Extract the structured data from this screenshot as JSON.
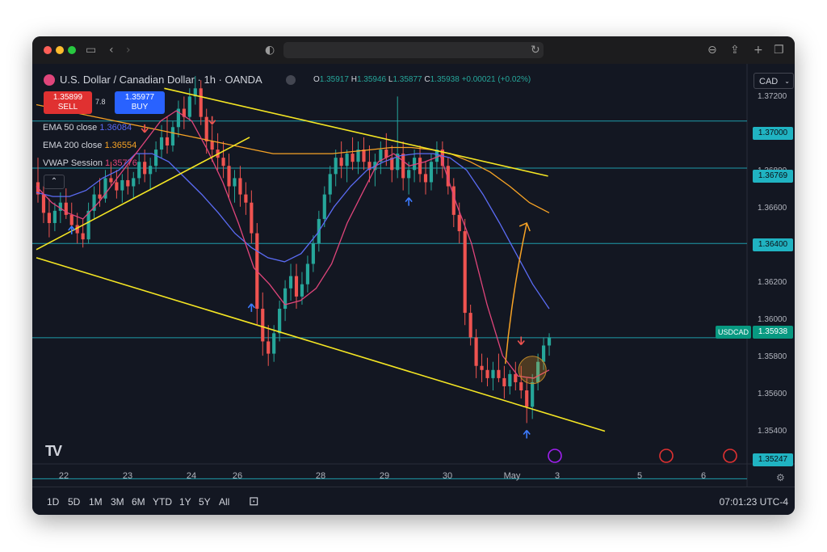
{
  "window": {
    "browser_icons": {
      "sidebar": "sidebar-icon",
      "back": "chevron-left-icon",
      "forward": "chevron-right-icon",
      "shield": "shield-icon",
      "reload": "reload-icon",
      "download": "download-icon",
      "share": "share-icon",
      "new_tab": "plus-icon",
      "tabs": "tabs-icon"
    },
    "traffic_colors": [
      "#ff5f57",
      "#febc2e",
      "#28c840"
    ]
  },
  "header": {
    "symbol": "U.S. Dollar / Canadian Dollar · 1h · OANDA",
    "ohlc": {
      "o_label": "O",
      "o": "1.35917",
      "h_label": "H",
      "h": "1.35946",
      "l_label": "L",
      "l": "1.35877",
      "c_label": "C",
      "c": "1.35938",
      "change": "+0.00021 (+0.02%)"
    },
    "currency": "CAD"
  },
  "trade": {
    "sell_price": "1.35899",
    "sell_label": "SELL",
    "spread": "7.8",
    "buy_price": "1.35977",
    "buy_label": "BUY"
  },
  "indicators": [
    {
      "label": "EMA 50 close",
      "value": "1.36084",
      "color": "#5b6cf5"
    },
    {
      "label": "EMA 200 close",
      "value": "1.36554",
      "color": "#f7a325"
    },
    {
      "label": "VWAP Session",
      "value": "1.35776",
      "color": "#e0457b"
    }
  ],
  "price_axis": {
    "ticks": [
      "1.37200",
      "1.36800",
      "1.36600",
      "1.36200",
      "1.36000",
      "1.35800",
      "1.35600",
      "1.35400"
    ],
    "level_labels": [
      "1.37000",
      "1.36769",
      "1.36400",
      "1.35247"
    ],
    "symbol_tag": "USDCAD",
    "last_price": "1.35938"
  },
  "time_axis": {
    "ticks": [
      "22",
      "23",
      "24",
      "26",
      "28",
      "29",
      "30",
      "May",
      "3",
      "5",
      "6"
    ]
  },
  "bottom": {
    "ranges": [
      "1D",
      "5D",
      "1M",
      "3M",
      "6M",
      "YTD",
      "1Y",
      "5Y",
      "All"
    ],
    "clock": "07:01:23 UTC-4"
  },
  "logo": "TV",
  "chart_data": {
    "type": "candlestick",
    "symbol": "USDCAD",
    "timeframe": "1h",
    "price_range": [
      1.353,
      1.3728
    ],
    "horizontal_levels": [
      1.37292,
      1.37,
      1.36769,
      1.364,
      1.35938,
      1.35247
    ],
    "colors": {
      "up": "#26a69a",
      "down": "#ef5350",
      "ema50": "#5b6cf5",
      "ema200": "#f7a325",
      "vwap": "#e0457b",
      "trend": "#f5e623",
      "level": "#20b3c2",
      "projection": "#f7a325"
    },
    "candles": [
      [
        1.367,
        1.3682,
        1.366,
        1.3664
      ],
      [
        1.3664,
        1.3668,
        1.365,
        1.3655
      ],
      [
        1.3655,
        1.3662,
        1.3643,
        1.365
      ],
      [
        1.365,
        1.366,
        1.3646,
        1.3656
      ],
      [
        1.3656,
        1.3665,
        1.365,
        1.366
      ],
      [
        1.366,
        1.3667,
        1.3652,
        1.3654
      ],
      [
        1.3654,
        1.366,
        1.3645,
        1.3649
      ],
      [
        1.3649,
        1.3655,
        1.364,
        1.3645
      ],
      [
        1.3645,
        1.3652,
        1.3638,
        1.3642
      ],
      [
        1.3642,
        1.366,
        1.364,
        1.3656
      ],
      [
        1.3656,
        1.3668,
        1.3652,
        1.3664
      ],
      [
        1.3664,
        1.3672,
        1.3658,
        1.3662
      ],
      [
        1.3662,
        1.3676,
        1.366,
        1.3672
      ],
      [
        1.3672,
        1.368,
        1.3668,
        1.367
      ],
      [
        1.367,
        1.3676,
        1.3662,
        1.3666
      ],
      [
        1.3666,
        1.3674,
        1.366,
        1.3671
      ],
      [
        1.3671,
        1.3678,
        1.3664,
        1.3668
      ],
      [
        1.3668,
        1.3675,
        1.3662,
        1.3672
      ],
      [
        1.3672,
        1.3684,
        1.3669,
        1.368
      ],
      [
        1.368,
        1.3686,
        1.367,
        1.3674
      ],
      [
        1.3674,
        1.3682,
        1.3666,
        1.3678
      ],
      [
        1.3678,
        1.369,
        1.3675,
        1.3686
      ],
      [
        1.3686,
        1.3698,
        1.3682,
        1.3692
      ],
      [
        1.3692,
        1.3702,
        1.3684,
        1.3688
      ],
      [
        1.3688,
        1.37,
        1.3685,
        1.3697
      ],
      [
        1.3697,
        1.371,
        1.3692,
        1.3706
      ],
      [
        1.3706,
        1.3712,
        1.3696,
        1.3702
      ],
      [
        1.3702,
        1.3716,
        1.37,
        1.3712
      ],
      [
        1.3712,
        1.3722,
        1.3708,
        1.3716
      ],
      [
        1.3716,
        1.372,
        1.3698,
        1.3702
      ],
      [
        1.3702,
        1.3706,
        1.3684,
        1.369
      ],
      [
        1.369,
        1.3698,
        1.368,
        1.3686
      ],
      [
        1.3686,
        1.3694,
        1.3676,
        1.3682
      ],
      [
        1.3682,
        1.369,
        1.3672,
        1.3678
      ],
      [
        1.3678,
        1.3684,
        1.3662,
        1.3668
      ],
      [
        1.3668,
        1.3676,
        1.366,
        1.3672
      ],
      [
        1.3672,
        1.3678,
        1.3658,
        1.3664
      ],
      [
        1.3664,
        1.367,
        1.3654,
        1.366
      ],
      [
        1.366,
        1.3666,
        1.364,
        1.3645
      ],
      [
        1.3645,
        1.365,
        1.36,
        1.3608
      ],
      [
        1.3608,
        1.3616,
        1.3585,
        1.3592
      ],
      [
        1.3592,
        1.36,
        1.358,
        1.3586
      ],
      [
        1.3586,
        1.36,
        1.3582,
        1.3596
      ],
      [
        1.3596,
        1.3612,
        1.3592,
        1.3608
      ],
      [
        1.3608,
        1.3622,
        1.3602,
        1.3618
      ],
      [
        1.3618,
        1.363,
        1.3612,
        1.3624
      ],
      [
        1.3624,
        1.363,
        1.3608,
        1.3614
      ],
      [
        1.3614,
        1.3626,
        1.361,
        1.362
      ],
      [
        1.362,
        1.3634,
        1.3616,
        1.363
      ],
      [
        1.363,
        1.3644,
        1.3626,
        1.364
      ],
      [
        1.364,
        1.3656,
        1.3636,
        1.3652
      ],
      [
        1.3652,
        1.3668,
        1.3648,
        1.3664
      ],
      [
        1.3664,
        1.3678,
        1.366,
        1.3674
      ],
      [
        1.3674,
        1.3686,
        1.3668,
        1.3682
      ],
      [
        1.3682,
        1.369,
        1.3672,
        1.3678
      ],
      [
        1.3678,
        1.3686,
        1.367,
        1.3684
      ],
      [
        1.3684,
        1.3692,
        1.3676,
        1.368
      ],
      [
        1.368,
        1.369,
        1.3674,
        1.3686
      ],
      [
        1.3686,
        1.3692,
        1.3676,
        1.368
      ],
      [
        1.368,
        1.3688,
        1.367,
        1.3676
      ],
      [
        1.3676,
        1.3684,
        1.3668,
        1.368
      ],
      [
        1.368,
        1.369,
        1.3674,
        1.3686
      ],
      [
        1.3686,
        1.3694,
        1.3678,
        1.3682
      ],
      [
        1.3682,
        1.3688,
        1.367,
        1.3676
      ],
      [
        1.3676,
        1.3712,
        1.3672,
        1.3684
      ],
      [
        1.3684,
        1.369,
        1.3666,
        1.3672
      ],
      [
        1.3672,
        1.368,
        1.3664,
        1.3676
      ],
      [
        1.3676,
        1.3686,
        1.367,
        1.3682
      ],
      [
        1.3682,
        1.3688,
        1.367,
        1.3674
      ],
      [
        1.3674,
        1.368,
        1.3664,
        1.367
      ],
      [
        1.367,
        1.3684,
        1.3666,
        1.368
      ],
      [
        1.368,
        1.369,
        1.3674,
        1.3686
      ],
      [
        1.3686,
        1.369,
        1.3672,
        1.3678
      ],
      [
        1.3678,
        1.3682,
        1.3664,
        1.3668
      ],
      [
        1.3668,
        1.3672,
        1.3648,
        1.3654
      ],
      [
        1.3654,
        1.366,
        1.364,
        1.3646
      ],
      [
        1.3646,
        1.3652,
        1.36,
        1.3606
      ],
      [
        1.3606,
        1.361,
        1.359,
        1.3594
      ],
      [
        1.3594,
        1.3598,
        1.3574,
        1.358
      ],
      [
        1.358,
        1.3586,
        1.3572,
        1.3578
      ],
      [
        1.3578,
        1.3584,
        1.357,
        1.3574
      ],
      [
        1.3574,
        1.3582,
        1.3568,
        1.3578
      ],
      [
        1.3578,
        1.3586,
        1.3572,
        1.3574
      ],
      [
        1.3574,
        1.358,
        1.3564,
        1.357
      ],
      [
        1.357,
        1.3578,
        1.3566,
        1.3576
      ],
      [
        1.3576,
        1.3582,
        1.3568,
        1.3572
      ],
      [
        1.3572,
        1.358,
        1.3564,
        1.3568
      ],
      [
        1.3568,
        1.3574,
        1.3552,
        1.356
      ],
      [
        1.356,
        1.3576,
        1.3554,
        1.3572
      ],
      [
        1.3572,
        1.3586,
        1.3568,
        1.3582
      ],
      [
        1.3582,
        1.3594,
        1.3578,
        1.359
      ],
      [
        1.359,
        1.3596,
        1.3585,
        1.3594
      ]
    ],
    "ema50": [
      1.3665,
      1.3663,
      1.3663,
      1.3666,
      1.3672,
      1.3676,
      1.3684,
      1.3684,
      1.368,
      1.3672,
      1.3664,
      1.3655,
      1.3645,
      1.3638,
      1.3633,
      1.3631,
      1.3635,
      1.3645,
      1.3658,
      1.3668,
      1.3676,
      1.368,
      1.3683,
      1.3684,
      1.3684,
      1.3682,
      1.3676,
      1.3664,
      1.365,
      1.3635,
      1.362,
      1.3608
    ],
    "ema200": [
      1.3708,
      1.3706,
      1.3704,
      1.3702,
      1.37,
      1.3698,
      1.3696,
      1.3694,
      1.3692,
      1.369,
      1.3688,
      1.3686,
      1.3684,
      1.3684,
      1.3684,
      1.3684,
      1.3685,
      1.3686,
      1.3687,
      1.3687,
      1.3686,
      1.3684,
      1.368,
      1.3675,
      1.3668,
      1.366,
      1.3655
    ],
    "vwap": [
      1.3668,
      1.366,
      1.3655,
      1.3652,
      1.366,
      1.367,
      1.368,
      1.369,
      1.37,
      1.3705,
      1.37,
      1.3686,
      1.367,
      1.365,
      1.3628,
      1.362,
      1.361,
      1.3612,
      1.3618,
      1.363,
      1.365,
      1.3665,
      1.368,
      1.3684,
      1.3678,
      1.368,
      1.3683,
      1.366,
      1.364,
      1.361,
      1.3585,
      1.3575,
      1.3574,
      1.3578
    ],
    "trend_lines": [
      {
        "from": [
          1.3637,
          0
        ],
        "to": [
          1.3692,
          0.3
        ]
      },
      {
        "from": [
          1.3716,
          0.18
        ],
        "to": [
          1.3673,
          0.72
        ]
      },
      {
        "from": [
          1.3633,
          0
        ],
        "to": [
          1.3548,
          0.8
        ]
      }
    ],
    "projection_arrow": {
      "from": [
        1.3581,
        0.66
      ],
      "to": [
        1.365,
        0.69
      ]
    },
    "annotations": [
      "buy arrows",
      "sell arrows",
      "highlight circle near 1.3580"
    ]
  }
}
